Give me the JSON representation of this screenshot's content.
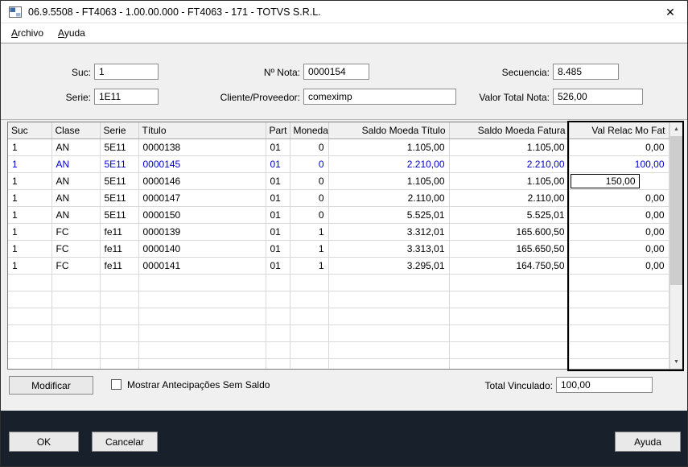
{
  "window": {
    "title": "06.9.5508 - FT4063 - 1.00.00.000 - FT4063 - 171 - TOTVS S.R.L."
  },
  "icons": {
    "close": "✕",
    "scroll_up": "▲",
    "scroll_down": "▼"
  },
  "colors": {
    "selected_row": "#0000cd",
    "bottom_bar": "#17202b"
  },
  "menu": {
    "items": [
      {
        "label": "Archivo"
      },
      {
        "label": "Ayuda"
      }
    ]
  },
  "form": {
    "suc": {
      "label": "Suc:",
      "value": "1"
    },
    "nota": {
      "label": "Nº Nota:",
      "value": "0000154"
    },
    "secuencia": {
      "label": "Secuencia:",
      "value": "8.485"
    },
    "serie": {
      "label": "Serie:",
      "value": "1E11"
    },
    "cliente": {
      "label": "Cliente/Proveedor:",
      "value": "comeximp"
    },
    "valor": {
      "label": "Valor Total Nota:",
      "value": "526,00"
    }
  },
  "table": {
    "columns": [
      {
        "key": "suc",
        "label": "Suc"
      },
      {
        "key": "clase",
        "label": "Clase"
      },
      {
        "key": "serie",
        "label": "Serie"
      },
      {
        "key": "titulo",
        "label": "Título"
      },
      {
        "key": "part",
        "label": "Part"
      },
      {
        "key": "moneda",
        "label": "Moneda"
      },
      {
        "key": "saldo_titulo",
        "label": "Saldo Moeda Título"
      },
      {
        "key": "saldo_fatura",
        "label": "Saldo Moeda Fatura"
      },
      {
        "key": "val_relac",
        "label": "Val Relac Mo Fat"
      }
    ],
    "rows": [
      {
        "suc": "1",
        "clase": "AN",
        "serie": "5E11",
        "titulo": "0000138",
        "part": "01",
        "moneda": "0",
        "saldo_titulo": "1.105,00",
        "saldo_fatura": "1.105,00",
        "val_relac": "0,00"
      },
      {
        "suc": "1",
        "clase": "AN",
        "serie": "5E11",
        "titulo": "0000145",
        "part": "01",
        "moneda": "0",
        "saldo_titulo": "2.210,00",
        "saldo_fatura": "2.210,00",
        "val_relac": "100,00",
        "selected": true
      },
      {
        "suc": "1",
        "clase": "AN",
        "serie": "5E11",
        "titulo": "0000146",
        "part": "01",
        "moneda": "0",
        "saldo_titulo": "1.105,00",
        "saldo_fatura": "1.105,00",
        "val_relac": "150,00",
        "editing": true
      },
      {
        "suc": "1",
        "clase": "AN",
        "serie": "5E11",
        "titulo": "0000147",
        "part": "01",
        "moneda": "0",
        "saldo_titulo": "2.110,00",
        "saldo_fatura": "2.110,00",
        "val_relac": "0,00"
      },
      {
        "suc": "1",
        "clase": "AN",
        "serie": "5E11",
        "titulo": "0000150",
        "part": "01",
        "moneda": "0",
        "saldo_titulo": "5.525,01",
        "saldo_fatura": "5.525,01",
        "val_relac": "0,00"
      },
      {
        "suc": "1",
        "clase": "FC",
        "serie": "fe11",
        "titulo": "0000139",
        "part": "01",
        "moneda": "1",
        "saldo_titulo": "3.312,01",
        "saldo_fatura": "165.600,50",
        "val_relac": "0,00"
      },
      {
        "suc": "1",
        "clase": "FC",
        "serie": "fe11",
        "titulo": "0000140",
        "part": "01",
        "moneda": "1",
        "saldo_titulo": "3.313,01",
        "saldo_fatura": "165.650,50",
        "val_relac": "0,00"
      },
      {
        "suc": "1",
        "clase": "FC",
        "serie": "fe11",
        "titulo": "0000141",
        "part": "01",
        "moneda": "1",
        "saldo_titulo": "3.295,01",
        "saldo_fatura": "164.750,50",
        "val_relac": "0,00"
      }
    ],
    "empty_rows": 6
  },
  "footer": {
    "modificar": "Modificar",
    "checkbox_label": "Mostrar Antecipações Sem Saldo",
    "checkbox_checked": false,
    "total": {
      "label": "Total Vinculado:",
      "value": "100,00"
    }
  },
  "actions": {
    "ok": "OK",
    "cancelar": "Cancelar",
    "ayuda": "Ayuda"
  }
}
